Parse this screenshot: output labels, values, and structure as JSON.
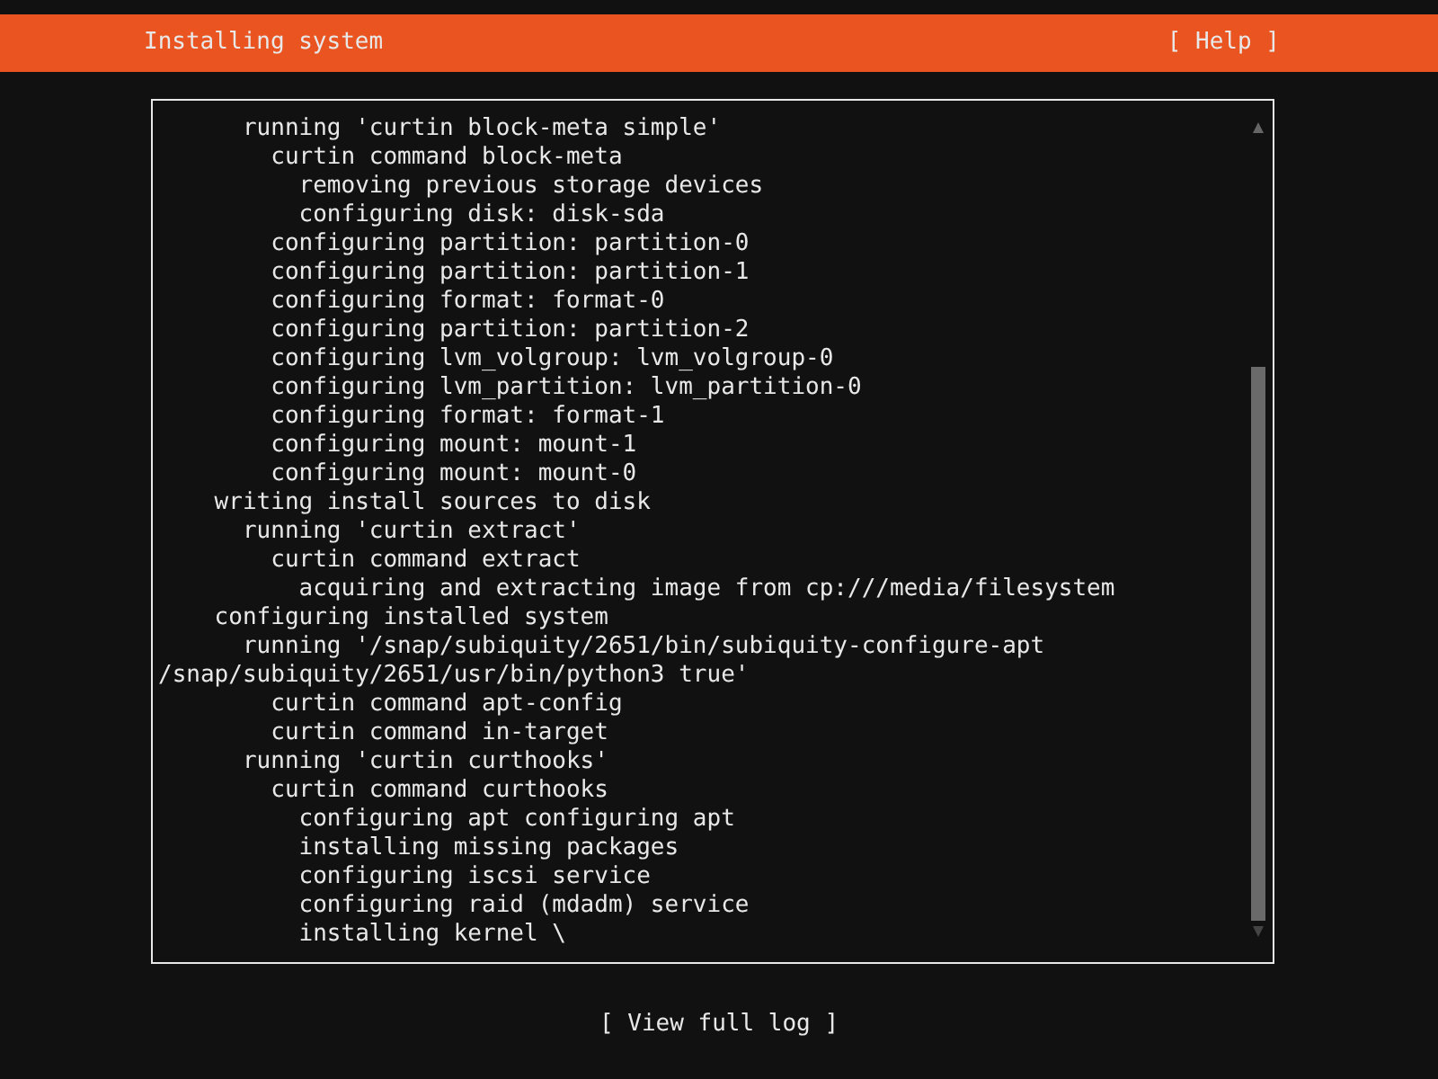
{
  "header": {
    "title": "Installing system",
    "help": "[ Help ]"
  },
  "log_lines": [
    "      running 'curtin block-meta simple'",
    "        curtin command block-meta",
    "          removing previous storage devices",
    "          configuring disk: disk-sda",
    "        configuring partition: partition-0",
    "        configuring partition: partition-1",
    "        configuring format: format-0",
    "        configuring partition: partition-2",
    "        configuring lvm_volgroup: lvm_volgroup-0",
    "        configuring lvm_partition: lvm_partition-0",
    "        configuring format: format-1",
    "        configuring mount: mount-1",
    "        configuring mount: mount-0",
    "    writing install sources to disk",
    "      running 'curtin extract'",
    "        curtin command extract",
    "          acquiring and extracting image from cp:///media/filesystem",
    "    configuring installed system",
    "      running '/snap/subiquity/2651/bin/subiquity-configure-apt",
    "/snap/subiquity/2651/usr/bin/python3 true'",
    "        curtin command apt-config",
    "        curtin command in-target",
    "      running 'curtin curthooks'",
    "        curtin command curthooks",
    "          configuring apt configuring apt",
    "          installing missing packages",
    "          configuring iscsi service",
    "          configuring raid (mdadm) service",
    "          installing kernel \\"
  ],
  "button": "[ View full log ]"
}
